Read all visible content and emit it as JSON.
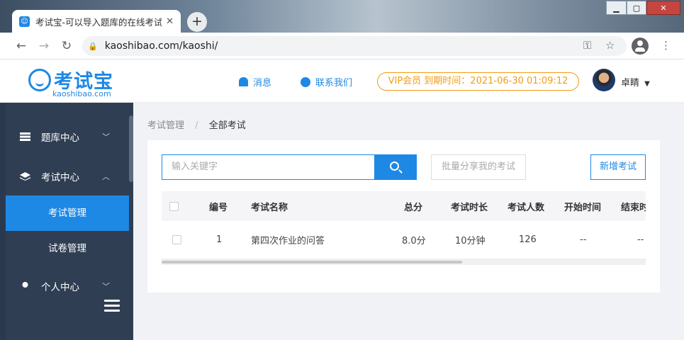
{
  "browser": {
    "tab_title": "考试宝-可以导入题库的在线考试",
    "url": "kaoshibao.com/kaoshi/"
  },
  "header": {
    "logo_name": "考试宝",
    "logo_domain": "kaoshibao.com",
    "messages": "消息",
    "contact": "联系我们",
    "vip": "VIP会员  到期时间：2021-06-30 01:09:12",
    "username": "卓睛"
  },
  "sidebar": {
    "items": [
      {
        "label": "题库中心",
        "icon": "list-icon",
        "chevron": "chevron-down-icon"
      },
      {
        "label": "考试中心",
        "icon": "layers-icon",
        "chevron": "chevron-up-icon"
      },
      {
        "label": "个人中心",
        "icon": "user-icon",
        "chevron": "chevron-down-icon"
      }
    ],
    "subitems": [
      "考试管理",
      "试卷管理"
    ]
  },
  "main": {
    "breadcrumb": [
      "考试管理",
      "全部考试"
    ],
    "search_placeholder": "输入关键字",
    "share_button": "批量分享我的考试",
    "add_button": "新增考试",
    "table": {
      "headers": [
        "编号",
        "考试名称",
        "总分",
        "考试时长",
        "考试人数",
        "开始时间",
        "结束时间"
      ],
      "rows": [
        [
          "1",
          "第四次作业的问答",
          "8.0分",
          "10分钟",
          "126",
          "--",
          "--"
        ]
      ]
    }
  },
  "colors": {
    "accent": "#1e88e5",
    "vip": "#f39c12",
    "sidebar": "#2f3e53"
  }
}
